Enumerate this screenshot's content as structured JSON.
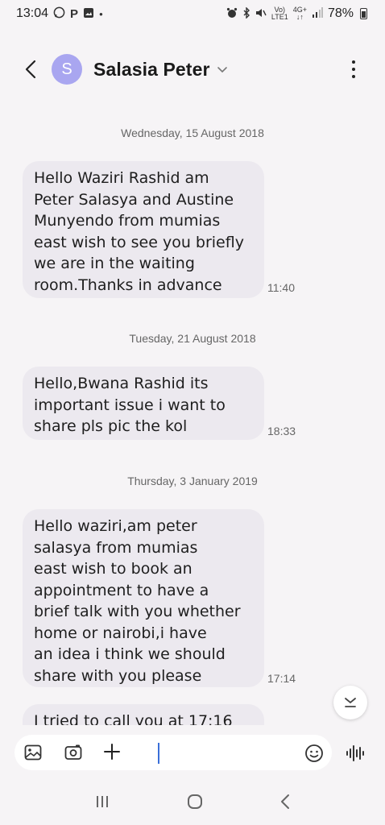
{
  "status_bar": {
    "time": "13:04",
    "left_icons": [
      "whatsapp-icon",
      "p-icon",
      "gallery-icon",
      "dot"
    ],
    "network_top": "Vo)",
    "network_bottom": "LTE1",
    "net_type_top": "4G+",
    "net_type_bottom": "↓↑",
    "battery": "78%"
  },
  "header": {
    "avatar_letter": "S",
    "contact_name": "Salasia Peter"
  },
  "messages": [
    {
      "date": "Wednesday, 15 August 2018",
      "lines": [
        "Hello Waziri Rashid am",
        "Peter Salasya and Austine",
        "Munyendo from mumias",
        "east wish to see you briefly",
        "we are in the waiting",
        "room.Thanks in advance"
      ],
      "time": "11:40"
    },
    {
      "date": "Tuesday, 21 August 2018",
      "lines": [
        "Hello,Bwana Rashid its",
        "important issue i want to",
        "share pls pic the kol"
      ],
      "time": "18:33"
    },
    {
      "date": "Thursday, 3 January 2019",
      "lines": [
        "Hello waziri,am peter",
        "salasya from mumias",
        "east wish to book an",
        "appointment to have a",
        "brief talk with you whether",
        "home or nairobi,i have",
        "an idea i think we should",
        "share with you please"
      ],
      "time": "17:14"
    },
    {
      "lines": [
        "I tried to call you at 17:16"
      ]
    }
  ],
  "colors": {
    "background": "#f6f4f6",
    "bubble": "#ece9ef",
    "avatar": "#a9a6f0",
    "cursor": "#3a6fd8"
  }
}
